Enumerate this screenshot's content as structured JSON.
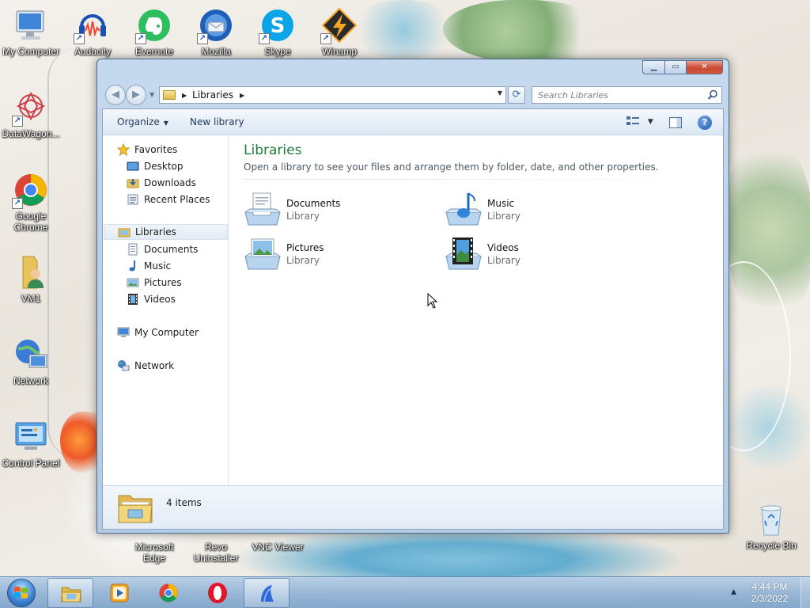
{
  "desktop": {
    "icons_top": [
      {
        "label": "My Computer",
        "icon": "my-computer-icon"
      },
      {
        "label": "Audacity",
        "icon": "audacity-icon"
      },
      {
        "label": "Evernote",
        "icon": "evernote-icon"
      },
      {
        "label": "Mozilla",
        "icon": "thunderbird-icon"
      },
      {
        "label": "Skype",
        "icon": "skype-icon"
      },
      {
        "label": "Winamp",
        "icon": "winamp-icon"
      }
    ],
    "icons_left": [
      {
        "label": "DataWagon...",
        "icon": "datawagon-icon"
      },
      {
        "label": "Google Chrome",
        "icon": "chrome-icon"
      },
      {
        "label": "VM1",
        "icon": "user-folder-icon"
      },
      {
        "label": "Network",
        "icon": "network-icon"
      },
      {
        "label": "Control Panel",
        "icon": "control-panel-icon"
      }
    ],
    "icons_bottom": [
      {
        "label": "Microsoft Edge",
        "icon": "edge-icon"
      },
      {
        "label": "Revo Uninstaller",
        "icon": "revo-icon"
      },
      {
        "label": "VNC Viewer",
        "icon": "vnc-icon"
      }
    ],
    "recycle_bin": {
      "label": "Recycle Bin",
      "icon": "recycle-bin-icon"
    }
  },
  "window": {
    "caption": {
      "minimize": "▁",
      "maximize": "▭",
      "close": "✕"
    },
    "address": {
      "crumbs": [
        "Libraries"
      ]
    },
    "search": {
      "placeholder": "Search Libraries"
    },
    "toolbar": {
      "organize": "Organize",
      "new_library": "New library"
    },
    "nav": {
      "favorites": {
        "label": "Favorites",
        "items": [
          "Desktop",
          "Downloads",
          "Recent Places"
        ]
      },
      "libraries": {
        "label": "Libraries",
        "items": [
          "Documents",
          "Music",
          "Pictures",
          "Videos"
        ]
      },
      "computer": "My Computer",
      "network": "Network"
    },
    "main": {
      "title": "Libraries",
      "description": "Open a library to see your files and arrange them by folder, date, and other properties.",
      "items": [
        {
          "name": "Documents",
          "type": "Library",
          "icon": "documents-library-icon"
        },
        {
          "name": "Music",
          "type": "Library",
          "icon": "music-library-icon"
        },
        {
          "name": "Pictures",
          "type": "Library",
          "icon": "pictures-library-icon"
        },
        {
          "name": "Videos",
          "type": "Library",
          "icon": "videos-library-icon"
        }
      ]
    },
    "details": {
      "count": "4 items"
    }
  },
  "taskbar": {
    "apps": [
      {
        "name": "Windows Explorer",
        "icon": "explorer-icon",
        "active": true
      },
      {
        "name": "Media Player",
        "icon": "media-player-icon",
        "active": false
      },
      {
        "name": "Google Chrome",
        "icon": "chrome-icon",
        "active": false
      },
      {
        "name": "Opera",
        "icon": "opera-icon",
        "active": false
      },
      {
        "name": "App",
        "icon": "app-icon",
        "active": true
      }
    ],
    "clock": {
      "time": "4:44 PM",
      "date": "2/3/2022"
    }
  },
  "colors": {
    "accent_green": "#1e7a3c",
    "close_red": "#c9472f",
    "folder_yellow": "#e2b94f"
  }
}
